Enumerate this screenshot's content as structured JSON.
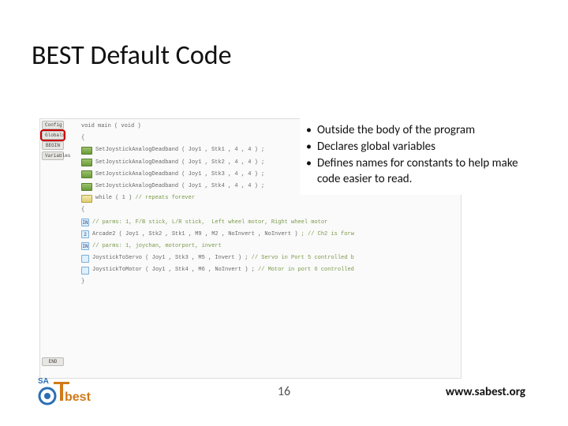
{
  "title": "BEST Default Code",
  "sidebar_btns": [
    "Config",
    "Globals",
    "BEGIN",
    "Variables"
  ],
  "highlight_index": 1,
  "code_rows": [
    {
      "icon": false,
      "text": "void main ( void )"
    },
    {
      "icon": false,
      "text": "{"
    },
    {
      "icon": "g",
      "text": "SetJoystickAnalogDeadband ( Joy1 , Stk1 , 4 , 4 ) ;"
    },
    {
      "icon": "g",
      "text": "SetJoystickAnalogDeadband ( Joy1 , Stk2 , 4 , 4 ) ;"
    },
    {
      "icon": "g",
      "text": "SetJoystickAnalogDeadband ( Joy1 , Stk3 , 4 , 4 ) ;"
    },
    {
      "icon": "g",
      "text": "SetJoystickAnalogDeadband ( Joy1 , Stk4 , 4 , 4 ) ;"
    },
    {
      "icon": "w",
      "text": "while ( 1 ) // repeats forever",
      "comment_from": 12
    },
    {
      "icon": false,
      "text": "{"
    },
    {
      "icon": "b",
      "badge": "IN",
      "text": "// parms: 1, F/B stick, L/R stick,  Left wheel motor, Right wheel motor",
      "is_comment": true
    },
    {
      "icon": "b",
      "badge": "2",
      "text": "Arcade2 ( Joy1 , Stk2 , Stk1 , M9 , M2 , NoInvert , NoInvert ) ; // Ch2 is forw",
      "comment_from": 62
    },
    {
      "icon": "b",
      "badge": "IN",
      "text": "// parms: 1, joychan, motorport, invert",
      "is_comment": true
    },
    {
      "icon": "b",
      "badge": "",
      "text": "JoystickToServo ( Joy1 , Stk3 , M5 , Invert ) ; // Servo in Port 5 controlled b",
      "comment_from": 48
    },
    {
      "icon": "b",
      "badge": "",
      "text": "JoystickToMotor ( Joy1 , Stk4 , M6 , NoInvert ) ; // Motor in port 6 controlled",
      "comment_from": 50
    },
    {
      "icon": false,
      "text": "}"
    }
  ],
  "end_btn": "END",
  "bullets": [
    "Outside the body of the program",
    "Declares global variables",
    "Defines names for constants to help make code easier to read."
  ],
  "page_number": "16",
  "footer_url": "www.sabest.org",
  "logo_text_top": "SA",
  "logo_text_main": "best"
}
